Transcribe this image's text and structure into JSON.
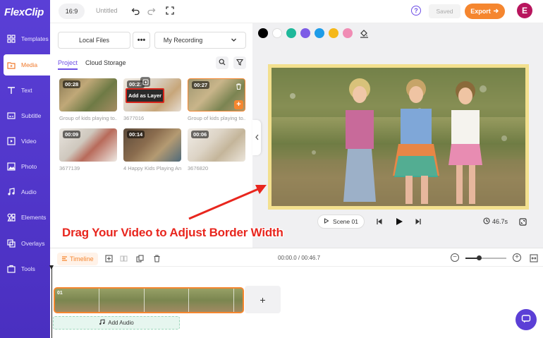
{
  "app": {
    "logo": "FlexClip"
  },
  "sidebar": {
    "items": [
      {
        "label": "Templates",
        "icon": "templates-icon"
      },
      {
        "label": "Media",
        "icon": "media-icon",
        "active": true
      },
      {
        "label": "Text",
        "icon": "text-icon"
      },
      {
        "label": "Subtitle",
        "icon": "subtitle-icon"
      },
      {
        "label": "Video",
        "icon": "video-icon"
      },
      {
        "label": "Photo",
        "icon": "photo-icon"
      },
      {
        "label": "Audio",
        "icon": "audio-icon"
      },
      {
        "label": "Elements",
        "icon": "elements-icon"
      },
      {
        "label": "Overlays",
        "icon": "overlays-icon"
      },
      {
        "label": "Tools",
        "icon": "tools-icon"
      }
    ]
  },
  "topbar": {
    "ratio": "16:9",
    "title": "Untitled",
    "saved_label": "Saved",
    "export_label": "Export",
    "avatar_letter": "E"
  },
  "media": {
    "local_files_label": "Local Files",
    "more_label": "•••",
    "recording_label": "My Recording",
    "tabs": [
      "Project",
      "Cloud Storage"
    ],
    "items": [
      {
        "duration": "00:28",
        "label": "Group of kids playing to..."
      },
      {
        "duration": "00:23",
        "label": "3677016"
      },
      {
        "duration": "00:27",
        "label": "Group of kids playing to..."
      },
      {
        "duration": "00:09",
        "label": "3677139"
      },
      {
        "duration": "00:14",
        "label": "4 Happy Kids Playing An..."
      },
      {
        "duration": "00:06",
        "label": "3676820"
      }
    ],
    "tooltip": "Add as Layer"
  },
  "stage": {
    "colors": [
      "#000000",
      "#ffffff",
      "#1fb89a",
      "#7d5ce6",
      "#1e9ce8",
      "#f5b81a",
      "#f08cb4"
    ],
    "accent_frame_color": "#f3e08e",
    "scene_label": "Scene 01",
    "duration": "46.7s"
  },
  "annotation": {
    "caption": "Drag Your Video to Adjust Border Width"
  },
  "timeline": {
    "label": "Timeline",
    "timecode": "00:00.0 / 00:46.7",
    "clip_number": "01",
    "add_audio_label": "Add Audio",
    "zoom_level": 0.33
  }
}
